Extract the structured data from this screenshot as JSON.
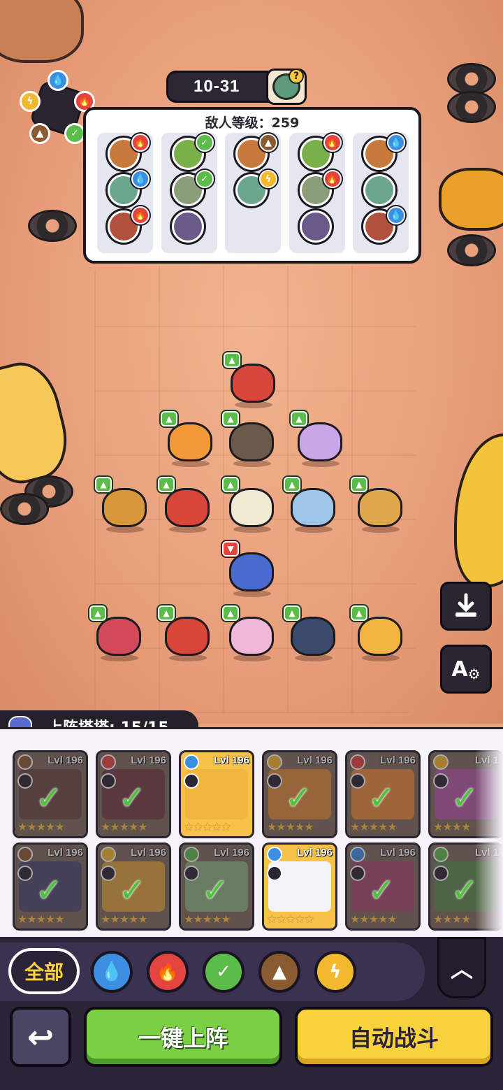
{
  "stage": {
    "label": "10-31",
    "boss_icon": "zombie-question-icon",
    "boss_badge": "?"
  },
  "enemy_panel": {
    "title": "敌人等级：259",
    "columns": [
      {
        "enemies": [
          {
            "element": "fire"
          },
          {
            "element": "water"
          },
          {
            "element": "fire"
          }
        ]
      },
      {
        "enemies": [
          {
            "element": "grass"
          },
          {
            "element": "grass"
          },
          {
            "element": ""
          }
        ]
      },
      {
        "enemies": [
          {
            "element": "earth"
          },
          {
            "element": "thunder"
          }
        ]
      },
      {
        "enemies": [
          {
            "element": "fire"
          },
          {
            "element": "fire"
          },
          {
            "element": ""
          }
        ]
      },
      {
        "enemies": [
          {
            "element": "water"
          },
          {
            "element": ""
          },
          {
            "element": "water"
          }
        ]
      }
    ]
  },
  "element_colors": {
    "water": "#3c8ee0",
    "fire": "#e2453f",
    "grass": "#5cbc4a",
    "earth": "#8a5a30",
    "thunder": "#f2b82e"
  },
  "field_units": [
    {
      "name": "plant-hero"
    },
    {
      "name": "fox-hero"
    },
    {
      "name": "monkey-hero"
    },
    {
      "name": "lilac-cat-hero"
    },
    {
      "name": "deer-hero"
    },
    {
      "name": "red-bird-hero"
    },
    {
      "name": "egg-nest-hero"
    },
    {
      "name": "blue-ghost-hero"
    },
    {
      "name": "lamp-hero"
    },
    {
      "name": "penguin-hero"
    },
    {
      "name": "crab-hero"
    },
    {
      "name": "lava-cat-hero"
    },
    {
      "name": "mantis-hero"
    },
    {
      "name": "crocodile-hero"
    },
    {
      "name": "lion-hero"
    }
  ],
  "side_buttons": {
    "download_icon": "download-tray-icon",
    "auto_settings_label": "A",
    "auto_settings_icon": "gear-icon"
  },
  "deploy": {
    "label": "上阵塔塔: 15/15"
  },
  "cards": [
    {
      "level": "Lvl 196",
      "element": "earth",
      "selected": true,
      "stars": "★★★★★"
    },
    {
      "level": "Lvl 196",
      "element": "fire",
      "selected": true,
      "stars": "★★★★★"
    },
    {
      "level": "Lvl 196",
      "element": "water",
      "selected": false,
      "stars": "★★★★★"
    },
    {
      "level": "Lvl 196",
      "element": "thunder",
      "selected": true,
      "stars": "★★★★★"
    },
    {
      "level": "Lvl 196",
      "element": "fire",
      "selected": true,
      "stars": "★★★★★"
    },
    {
      "level": "Lvl 1",
      "element": "thunder",
      "selected": true,
      "stars": "★★★★"
    },
    {
      "level": "Lvl 196",
      "element": "earth",
      "selected": true,
      "stars": "★★★★★"
    },
    {
      "level": "Lvl 196",
      "element": "thunder",
      "selected": true,
      "stars": "★★★★★"
    },
    {
      "level": "Lvl 196",
      "element": "grass",
      "selected": true,
      "stars": "★★★★★"
    },
    {
      "level": "Lvl 196",
      "element": "water",
      "selected": false,
      "stars": "★★★★★"
    },
    {
      "level": "Lvl 196",
      "element": "water",
      "selected": true,
      "stars": "★★★★★"
    },
    {
      "level": "Lvl 1",
      "element": "grass",
      "selected": true,
      "stars": "★★★★"
    }
  ],
  "filters": {
    "all_label": "全部",
    "elements": [
      "water",
      "fire",
      "grass",
      "earth",
      "thunder"
    ]
  },
  "actions": {
    "collapse_label": "︿",
    "back_label": "↩",
    "deploy_label": "一键上阵",
    "auto_label": "自动战斗"
  }
}
